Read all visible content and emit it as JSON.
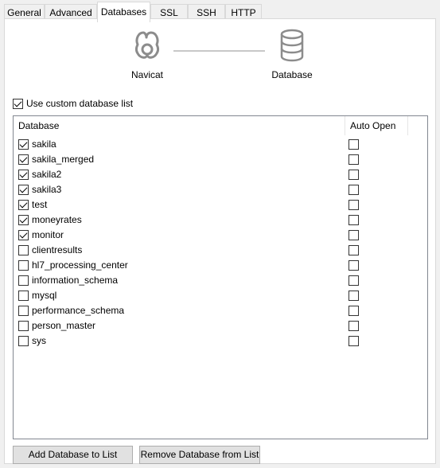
{
  "tabs": [
    {
      "label": "General"
    },
    {
      "label": "Advanced"
    },
    {
      "label": "Databases",
      "active": true
    },
    {
      "label": "SSL"
    },
    {
      "label": "SSH"
    },
    {
      "label": "HTTP"
    }
  ],
  "diagram": {
    "left_label": "Navicat",
    "left_icon": "navicat-icon",
    "right_label": "Database",
    "right_icon": "database-icon"
  },
  "custom_list": {
    "label": "Use custom database list",
    "checked": true
  },
  "list": {
    "columns": [
      "Database",
      "Auto Open"
    ],
    "rows": [
      {
        "name": "sakila",
        "checked": true,
        "auto_open": false
      },
      {
        "name": "sakila_merged",
        "checked": true,
        "auto_open": false
      },
      {
        "name": "sakila2",
        "checked": true,
        "auto_open": false
      },
      {
        "name": "sakila3",
        "checked": true,
        "auto_open": false
      },
      {
        "name": "test",
        "checked": true,
        "auto_open": false
      },
      {
        "name": "moneyrates",
        "checked": true,
        "auto_open": false
      },
      {
        "name": "monitor",
        "checked": true,
        "auto_open": false
      },
      {
        "name": "clientresults",
        "checked": false,
        "auto_open": false
      },
      {
        "name": "hl7_processing_center",
        "checked": false,
        "auto_open": false
      },
      {
        "name": "information_schema",
        "checked": false,
        "auto_open": false
      },
      {
        "name": "mysql",
        "checked": false,
        "auto_open": false
      },
      {
        "name": "performance_schema",
        "checked": false,
        "auto_open": false
      },
      {
        "name": "person_master",
        "checked": false,
        "auto_open": false
      },
      {
        "name": "sys",
        "checked": false,
        "auto_open": false
      }
    ]
  },
  "buttons": {
    "add": "Add Database to List",
    "remove": "Remove Database from List"
  }
}
